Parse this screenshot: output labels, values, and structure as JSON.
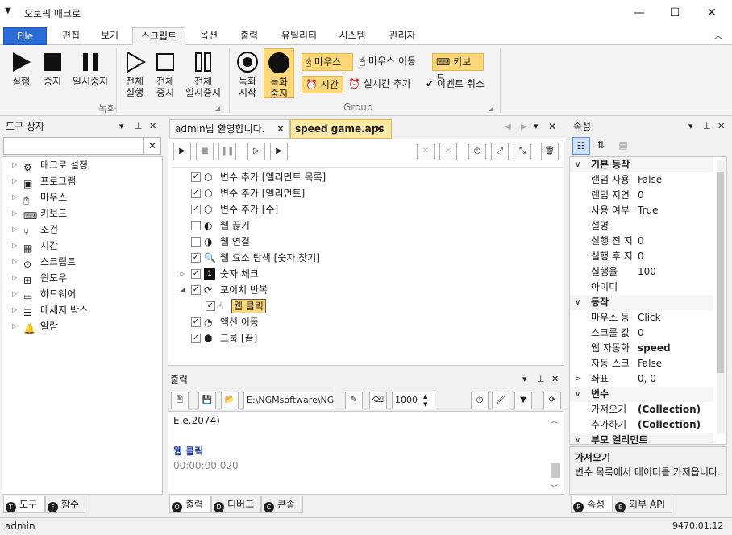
{
  "window": {
    "title": "오토픽 매크로",
    "minimize": "—",
    "maximize": "☐",
    "close": "✕"
  },
  "ribbon_tabs": [
    "File",
    "편집",
    "보기",
    "스크립트",
    "옵션",
    "출력",
    "유틸리티",
    "시스템",
    "관리자"
  ],
  "ribbon": {
    "run": "실행",
    "stop": "중지",
    "pause": "일시중지",
    "run_all_1": "전체",
    "run_all_2": "실행",
    "stop_all_1": "전체",
    "stop_all_2": "중지",
    "pause_all_1": "전체",
    "pause_all_2": "일시중지",
    "group1": "녹화",
    "rec_start_1": "녹화",
    "rec_start_2": "시작",
    "rec_stop_1": "녹화",
    "rec_stop_2": "중지",
    "mouse": "마우스",
    "mouse_move": "마우스 이동",
    "keyboard": "키보드",
    "time": "시간",
    "realtime_add": "실시간 추가",
    "event_cancel": "이벤트 취소",
    "group2": "Group"
  },
  "toolbox": {
    "title": "도구 상자",
    "items": [
      "매크로 설정",
      "프로그램",
      "마우스",
      "키보드",
      "조건",
      "시간",
      "스크립트",
      "윈도우",
      "하드웨어",
      "메세지 박스",
      "알람"
    ],
    "tabs": [
      "도구",
      "함수"
    ]
  },
  "doc_tabs": [
    "admin님 환영합니다.",
    "speed game.aps"
  ],
  "script_items": [
    {
      "label": "변수 추가 [엘리먼트 목록]",
      "checked": true
    },
    {
      "label": "변수 추가 [엘리먼트]",
      "checked": true
    },
    {
      "label": "변수 추가 [수]",
      "checked": true
    },
    {
      "label": "웹 끊기",
      "checked": false
    },
    {
      "label": "웹 연결",
      "checked": false
    },
    {
      "label": "웹 요소 탐색 [숫자 찾기]",
      "checked": true
    },
    {
      "label": "숫자 체크",
      "checked": true
    },
    {
      "label": "포이치 반복",
      "checked": true
    },
    {
      "label": "웹 클릭",
      "checked": true
    },
    {
      "label": "액션 이동",
      "checked": true
    },
    {
      "label": "그룹 [끝]",
      "checked": true
    }
  ],
  "output": {
    "title": "출력",
    "path": "E:\\NGMsoftware\\NG",
    "interval": "1000",
    "line1": "E.e.2074)",
    "line2": "웹 클릭",
    "line3": "00:00:00.020",
    "tabs": [
      "출력",
      "디버그",
      "콘솔"
    ]
  },
  "properties": {
    "title": "속성",
    "cat1": "기본 동작",
    "rows1": [
      [
        "랜덤 사용",
        "False"
      ],
      [
        "랜덤 지연",
        "0"
      ],
      [
        "사용 여부",
        "True"
      ],
      [
        "설명",
        ""
      ],
      [
        "실행 전 지",
        "0"
      ],
      [
        "실행 후 지",
        "0"
      ],
      [
        "실행율",
        "100"
      ],
      [
        "아이디",
        ""
      ]
    ],
    "cat2": "동작",
    "rows2": [
      [
        "마우스 동",
        "Click"
      ],
      [
        "스크롤 값",
        "0"
      ],
      [
        "웹 자동화",
        "speed"
      ],
      [
        "자동 스크",
        "False"
      ]
    ],
    "coord_key": "좌표",
    "coord_val": "0, 0",
    "cat3": "변수",
    "rows3": [
      [
        "가져오기",
        "(Collection)"
      ],
      [
        "추가하기",
        "(Collection)"
      ]
    ],
    "cat4": "부모 엘리먼트",
    "desc_title": "가져오기",
    "desc_text": "변수 목록에서 데이터를 가져옵니다.",
    "tabs": [
      "속성",
      "외부 API"
    ]
  },
  "status": {
    "user": "admin",
    "right": "9470:01:12"
  }
}
